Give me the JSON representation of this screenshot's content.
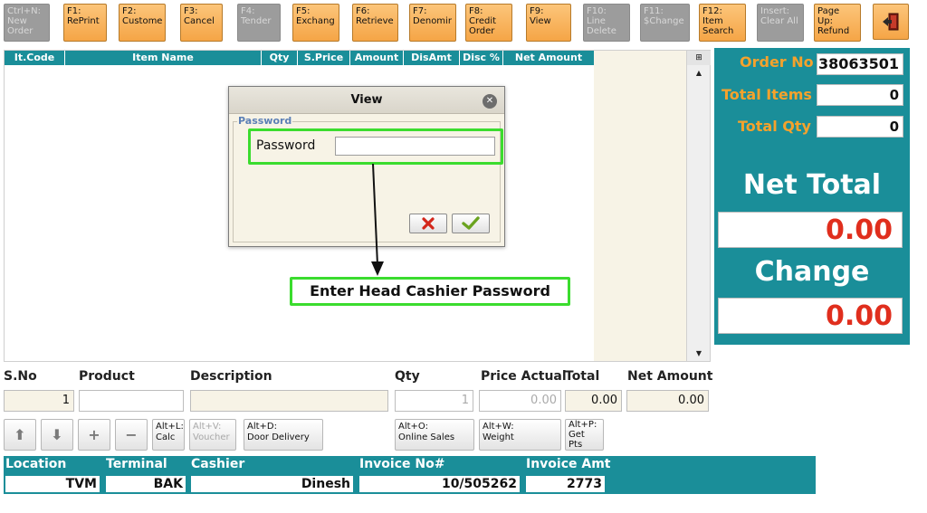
{
  "toolbar": {
    "buttons": [
      {
        "label": "Ctrl+N:\nNew\nOrder",
        "enabled": false
      },
      {
        "label": "F1:\nRePrint",
        "enabled": true
      },
      {
        "label": "F2:\nCustome",
        "enabled": true
      },
      {
        "label": "F3:\nCancel",
        "enabled": true
      },
      {
        "label": "F4:\nTender",
        "enabled": false
      },
      {
        "label": "F5:\nExchang",
        "enabled": true
      },
      {
        "label": "F6:\nRetrieve",
        "enabled": true
      },
      {
        "label": "F7:\nDenomir",
        "enabled": true
      },
      {
        "label": "F8:\nCredit\nOrder",
        "enabled": true
      },
      {
        "label": "F9:\nView",
        "enabled": true
      },
      {
        "label": "F10:\nLine\nDelete",
        "enabled": false
      },
      {
        "label": "F11:\n$Change",
        "enabled": false
      },
      {
        "label": "F12:\nItem\nSearch",
        "enabled": true
      },
      {
        "label": "Insert:\nClear All",
        "enabled": false
      },
      {
        "label": "Page\nUp:\nRefund",
        "enabled": true
      }
    ],
    "exit_icon": "exit-door-icon"
  },
  "grid": {
    "columns": [
      "It.Code",
      "Item Name",
      "Qty",
      "S.Price",
      "Amount",
      "DisAmt",
      "Disc %",
      "Net Amount"
    ]
  },
  "dialog": {
    "title": "View",
    "group_label": "Password",
    "field_label": "Password",
    "field_value": ""
  },
  "annotation": {
    "text": "Enter Head Cashier Password",
    "color": "#3bdc2e"
  },
  "panel": {
    "order_no_label": "Order No",
    "order_no_value": "38063501",
    "total_items_label": "Total Items",
    "total_items_value": "0",
    "total_qty_label": "Total Qty",
    "total_qty_value": "0",
    "net_total_label": "Net Total",
    "net_total_value": "0.00",
    "change_label": "Change",
    "change_value": "0.00"
  },
  "entry": {
    "labels": {
      "sno": "S.No",
      "product": "Product",
      "description": "Description",
      "qty": "Qty",
      "price_actual": "Price Actual",
      "total": "Total",
      "net_amount": "Net Amount"
    },
    "values": {
      "sno": "1",
      "product": "",
      "description": "",
      "qty": "1",
      "price_actual": "0.00",
      "total": "0.00",
      "net_amount": "0.00"
    }
  },
  "actions": {
    "calc": "Alt+L:\nCalc",
    "voucher": "Alt+V:\nVoucher",
    "door_delivery": "Alt+D:\nDoor Delivery",
    "online_sales": "Alt+O:\nOnline Sales",
    "weight": "Alt+W:\nWeight",
    "get_pts": "Alt+P:\nGet\nPts"
  },
  "footer": {
    "location_label": "Location",
    "location_value": "TVM",
    "terminal_label": "Terminal",
    "terminal_value": "BAK",
    "cashier_label": "Cashier",
    "cashier_value": "Dinesh",
    "invoice_no_label": "Invoice No#",
    "invoice_no_value": "10/505262",
    "invoice_amt_label": "Invoice Amt",
    "invoice_amt_value": "2773"
  },
  "colors": {
    "teal": "#1a8e99",
    "orange": "#f5a546",
    "accent_orange_text": "#f5a22c",
    "red_value": "#e02e1d",
    "highlight_green": "#3bdc2e"
  }
}
